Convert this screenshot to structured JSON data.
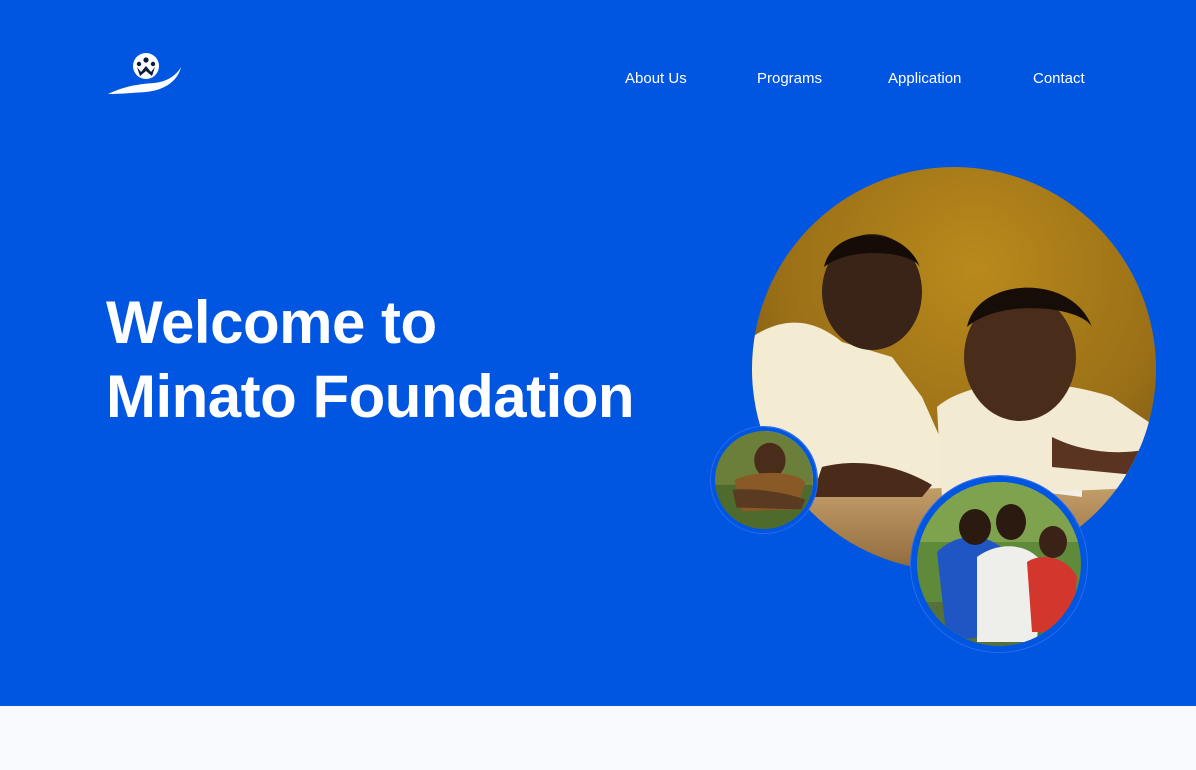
{
  "brand": {
    "logo_icon": "foundation-logo-icon",
    "accent_color": "#0056e0",
    "text_color": "#ffffff",
    "page_background": "#f8f9fd"
  },
  "nav": {
    "items": [
      {
        "label": "About Us"
      },
      {
        "label": "Programs"
      },
      {
        "label": "Application"
      },
      {
        "label": "Contact"
      }
    ]
  },
  "hero": {
    "headline_line1": "Welcome to",
    "headline_line2": "Minato Foundation"
  },
  "images": {
    "main": "children-reading-photo",
    "small": "smiling-boy-photo",
    "secondary": "children-hugging-photo"
  }
}
